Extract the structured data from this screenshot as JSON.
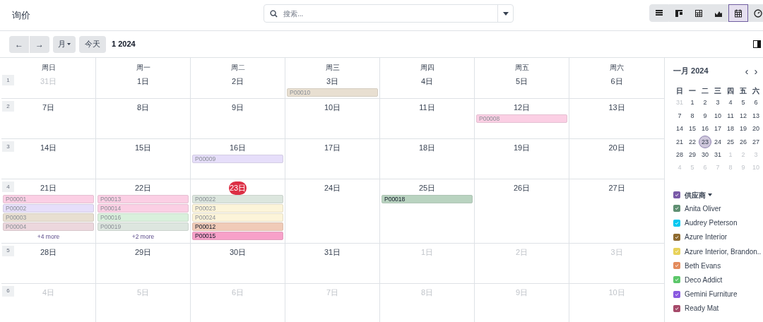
{
  "breadcrumb": "询价",
  "search": {
    "placeholder": "搜索..."
  },
  "view_buttons": [
    {
      "kind": "list",
      "selected": false
    },
    {
      "kind": "kanban",
      "selected": false
    },
    {
      "kind": "pivot",
      "selected": false
    },
    {
      "kind": "graph",
      "selected": false
    },
    {
      "kind": "calendar",
      "selected": true
    },
    {
      "kind": "activity",
      "selected": false
    }
  ],
  "toolbar": {
    "prev": "←",
    "next": "→",
    "scale": "月",
    "today": "今天",
    "period": "1 2024"
  },
  "weekdays": [
    "周日",
    "周一",
    "周二",
    "周三",
    "周四",
    "周五",
    "周六"
  ],
  "weeks": [
    {
      "number": "1",
      "days": [
        {
          "label": "31日",
          "muted": true,
          "today": false
        },
        {
          "label": "1日",
          "muted": false,
          "today": false
        },
        {
          "label": "2日",
          "muted": false,
          "today": false
        },
        {
          "label": "3日",
          "muted": false,
          "today": false,
          "events": [
            {
              "code": "P00010",
              "color": "#e8dfd1",
              "faded": true
            }
          ]
        },
        {
          "label": "4日",
          "muted": false,
          "today": false
        },
        {
          "label": "5日",
          "muted": false,
          "today": false
        },
        {
          "label": "6日",
          "muted": false,
          "today": false
        }
      ]
    },
    {
      "number": "2",
      "days": [
        {
          "label": "7日",
          "muted": false,
          "today": false
        },
        {
          "label": "8日",
          "muted": false,
          "today": false
        },
        {
          "label": "9日",
          "muted": false,
          "today": false
        },
        {
          "label": "10日",
          "muted": false,
          "today": false
        },
        {
          "label": "11日",
          "muted": false,
          "today": false
        },
        {
          "label": "12日",
          "muted": false,
          "today": false,
          "events": [
            {
              "code": "P00008",
              "color": "#fbcfe4",
              "faded": true
            }
          ]
        },
        {
          "label": "13日",
          "muted": false,
          "today": false
        }
      ]
    },
    {
      "number": "3",
      "days": [
        {
          "label": "14日",
          "muted": false,
          "today": false
        },
        {
          "label": "15日",
          "muted": false,
          "today": false
        },
        {
          "label": "16日",
          "muted": false,
          "today": false,
          "events": [
            {
              "code": "P00009",
              "color": "#e6defa",
              "faded": true
            }
          ]
        },
        {
          "label": "17日",
          "muted": false,
          "today": false
        },
        {
          "label": "18日",
          "muted": false,
          "today": false
        },
        {
          "label": "19日",
          "muted": false,
          "today": false
        },
        {
          "label": "20日",
          "muted": false,
          "today": false
        }
      ]
    },
    {
      "number": "4",
      "days": [
        {
          "label": "21日",
          "muted": false,
          "today": false,
          "events": [
            {
              "code": "P00001",
              "color": "#fbcfe4",
              "faded": true
            },
            {
              "code": "P00002",
              "color": "#e6defa",
              "faded": true
            },
            {
              "code": "P00003",
              "color": "#e8dfd1",
              "faded": true
            },
            {
              "code": "P00004",
              "color": "#ecd7dd",
              "faded": true
            }
          ],
          "more": "+4 more"
        },
        {
          "label": "22日",
          "muted": false,
          "today": false,
          "events": [
            {
              "code": "P00013",
              "color": "#fbcfe4",
              "faded": true
            },
            {
              "code": "P00014",
              "color": "#fbcfe4",
              "faded": true
            },
            {
              "code": "P00016",
              "color": "#d9f0dc",
              "faded": true
            },
            {
              "code": "P00019",
              "color": "#dde6df",
              "faded": true
            }
          ],
          "more": "+2 more"
        },
        {
          "label": "23日",
          "muted": false,
          "today": true,
          "events": [
            {
              "code": "P00022",
              "color": "#dce6de",
              "faded": true
            },
            {
              "code": "P00023",
              "color": "#fcf4d9",
              "faded": true
            },
            {
              "code": "P00024",
              "color": "#fcf4d9",
              "faded": true
            },
            {
              "code": "P00012",
              "color": "#f0cbb8",
              "faded": false
            },
            {
              "code": "P00015",
              "color": "#f7a1c9",
              "faded": false
            }
          ]
        },
        {
          "label": "24日",
          "muted": false,
          "today": false
        },
        {
          "label": "25日",
          "muted": false,
          "today": false,
          "events": [
            {
              "code": "P00018",
              "color": "#b9d3c0",
              "faded": false
            }
          ]
        },
        {
          "label": "26日",
          "muted": false,
          "today": false
        },
        {
          "label": "27日",
          "muted": false,
          "today": false
        }
      ]
    },
    {
      "number": "5",
      "days": [
        {
          "label": "28日",
          "muted": false,
          "today": false
        },
        {
          "label": "29日",
          "muted": false,
          "today": false
        },
        {
          "label": "30日",
          "muted": false,
          "today": false
        },
        {
          "label": "31日",
          "muted": false,
          "today": false
        },
        {
          "label": "1日",
          "muted": true,
          "today": false
        },
        {
          "label": "2日",
          "muted": true,
          "today": false
        },
        {
          "label": "3日",
          "muted": true,
          "today": false
        }
      ]
    },
    {
      "number": "6",
      "days": [
        {
          "label": "4日",
          "muted": true,
          "today": false
        },
        {
          "label": "5日",
          "muted": true,
          "today": false
        },
        {
          "label": "6日",
          "muted": true,
          "today": false
        },
        {
          "label": "7日",
          "muted": true,
          "today": false
        },
        {
          "label": "8日",
          "muted": true,
          "today": false
        },
        {
          "label": "9日",
          "muted": true,
          "today": false
        },
        {
          "label": "10日",
          "muted": true,
          "today": false
        }
      ]
    }
  ],
  "mini_calendar": {
    "title": "一月 2024",
    "prev": "‹",
    "next": "›",
    "weekdays": [
      "日",
      "一",
      "二",
      "三",
      "四",
      "五",
      "六"
    ],
    "days": [
      {
        "label": "31",
        "muted": true,
        "selected": false
      },
      {
        "label": "1",
        "muted": false,
        "selected": false
      },
      {
        "label": "2",
        "muted": false,
        "selected": false
      },
      {
        "label": "3",
        "muted": false,
        "selected": false
      },
      {
        "label": "4",
        "muted": false,
        "selected": false
      },
      {
        "label": "5",
        "muted": false,
        "selected": false
      },
      {
        "label": "6",
        "muted": false,
        "selected": false
      },
      {
        "label": "7",
        "muted": false,
        "selected": false
      },
      {
        "label": "8",
        "muted": false,
        "selected": false
      },
      {
        "label": "9",
        "muted": false,
        "selected": false
      },
      {
        "label": "10",
        "muted": false,
        "selected": false
      },
      {
        "label": "11",
        "muted": false,
        "selected": false
      },
      {
        "label": "12",
        "muted": false,
        "selected": false
      },
      {
        "label": "13",
        "muted": false,
        "selected": false
      },
      {
        "label": "14",
        "muted": false,
        "selected": false
      },
      {
        "label": "15",
        "muted": false,
        "selected": false
      },
      {
        "label": "16",
        "muted": false,
        "selected": false
      },
      {
        "label": "17",
        "muted": false,
        "selected": false
      },
      {
        "label": "18",
        "muted": false,
        "selected": false
      },
      {
        "label": "19",
        "muted": false,
        "selected": false
      },
      {
        "label": "20",
        "muted": false,
        "selected": false
      },
      {
        "label": "21",
        "muted": false,
        "selected": false
      },
      {
        "label": "22",
        "muted": false,
        "selected": false
      },
      {
        "label": "23",
        "muted": false,
        "selected": true
      },
      {
        "label": "24",
        "muted": false,
        "selected": false
      },
      {
        "label": "25",
        "muted": false,
        "selected": false
      },
      {
        "label": "26",
        "muted": false,
        "selected": false
      },
      {
        "label": "27",
        "muted": false,
        "selected": false
      },
      {
        "label": "28",
        "muted": false,
        "selected": false
      },
      {
        "label": "29",
        "muted": false,
        "selected": false
      },
      {
        "label": "30",
        "muted": false,
        "selected": false
      },
      {
        "label": "31",
        "muted": false,
        "selected": false
      },
      {
        "label": "1",
        "muted": true,
        "selected": false
      },
      {
        "label": "2",
        "muted": true,
        "selected": false
      },
      {
        "label": "3",
        "muted": true,
        "selected": false
      },
      {
        "label": "4",
        "muted": true,
        "selected": false
      },
      {
        "label": "5",
        "muted": true,
        "selected": false
      },
      {
        "label": "6",
        "muted": true,
        "selected": false
      },
      {
        "label": "7",
        "muted": true,
        "selected": false
      },
      {
        "label": "8",
        "muted": true,
        "selected": false
      },
      {
        "label": "9",
        "muted": true,
        "selected": false
      },
      {
        "label": "10",
        "muted": true,
        "selected": false
      }
    ]
  },
  "filter": {
    "title": "供应商",
    "color": "#7a5aa8",
    "checked": true,
    "items": [
      {
        "label": "Anita Oliver",
        "color": "#5f8f72",
        "checked": true
      },
      {
        "label": "Audrey Peterson",
        "color": "#00c8f0",
        "checked": true
      },
      {
        "label": "Azure Interior",
        "color": "#8e6a2f",
        "checked": true
      },
      {
        "label": "Azure Interior, Brandon..",
        "color": "#e8d25a",
        "checked": true
      },
      {
        "label": "Beth Evans",
        "color": "#e38b5c",
        "checked": true
      },
      {
        "label": "Deco Addict",
        "color": "#5cc76a",
        "checked": true
      },
      {
        "label": "Gemini Furniture",
        "color": "#8a5ae0",
        "checked": true
      },
      {
        "label": "Ready Mat",
        "color": "#a64a6a",
        "checked": true
      }
    ]
  }
}
